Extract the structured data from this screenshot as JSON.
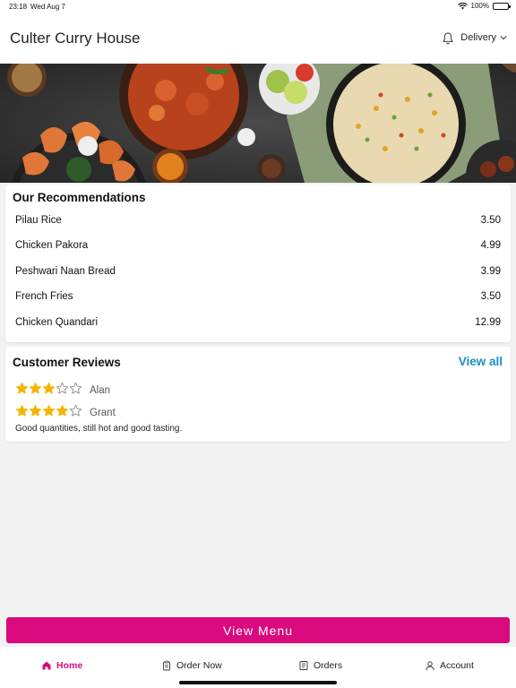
{
  "status_bar": {
    "time": "23:18",
    "date": "Wed Aug 7",
    "battery": "100%"
  },
  "header": {
    "title": "Culter Curry House",
    "mode_label": "Delivery"
  },
  "recommendations": {
    "title": "Our Recommendations",
    "items": [
      {
        "name": "Pilau Rice",
        "price": "3.50"
      },
      {
        "name": "Chicken Pakora",
        "price": "4.99"
      },
      {
        "name": "Peshwari Naan Bread",
        "price": "3.99"
      },
      {
        "name": "French Fries",
        "price": "3.50"
      },
      {
        "name": "Chicken Quandari",
        "price": "12.99"
      }
    ]
  },
  "reviews": {
    "title": "Customer Reviews",
    "view_all_label": "View all",
    "items": [
      {
        "name": "Alan",
        "rating": 3,
        "max": 5
      },
      {
        "name": "Grant",
        "rating": 4,
        "max": 5,
        "text": "Good quantities, still hot and good tasting."
      }
    ]
  },
  "view_menu_label": "View Menu",
  "tabs": [
    {
      "label": "Home",
      "icon": "home-icon",
      "active": true
    },
    {
      "label": "Order Now",
      "icon": "clipboard-icon"
    },
    {
      "label": "Orders",
      "icon": "receipt-icon"
    },
    {
      "label": "Account",
      "icon": "person-icon"
    }
  ],
  "colors": {
    "accent": "#d90a7d",
    "link": "#1a8fc9",
    "star": "#f5b400"
  }
}
